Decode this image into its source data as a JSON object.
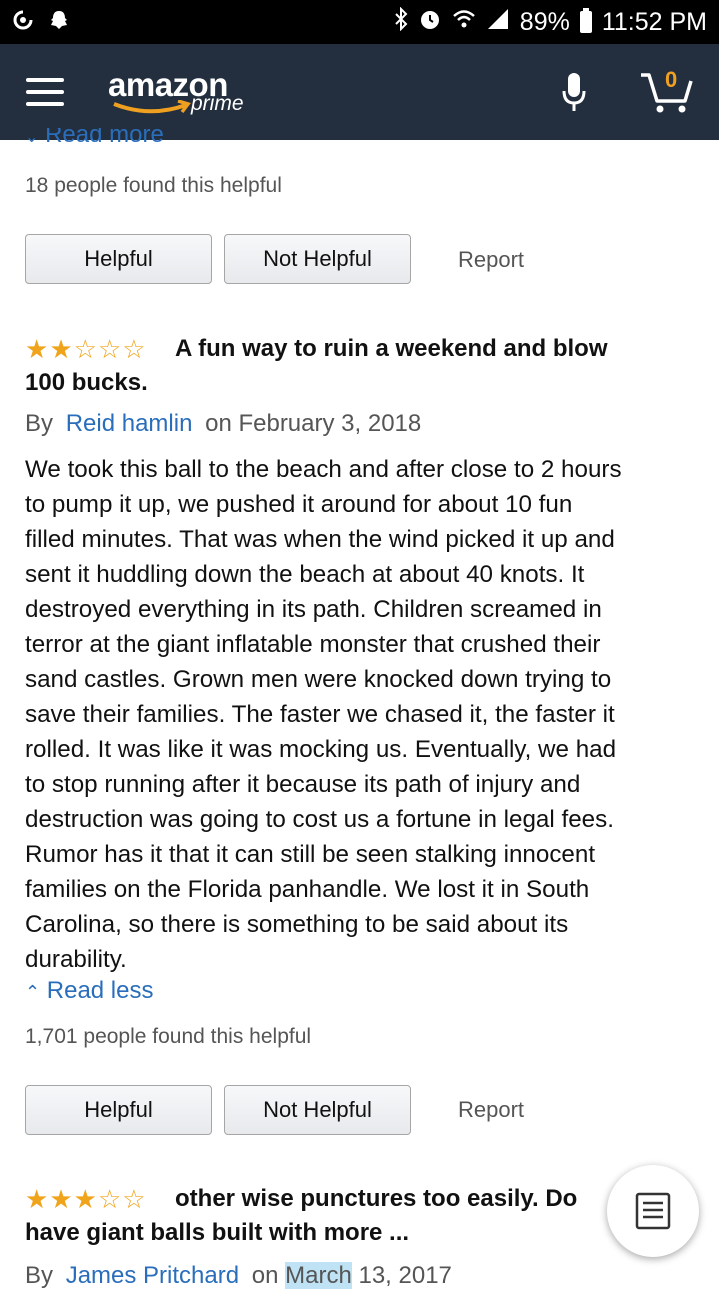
{
  "status_bar": {
    "battery": "89%",
    "time": "11:52 PM"
  },
  "header": {
    "logo_word": "amazon",
    "logo_sub": "prime",
    "cart_count": "0"
  },
  "top_partial": {
    "read_more": "Read more",
    "helpful_count": "18 people found this helpful"
  },
  "buttons": {
    "helpful": "Helpful",
    "not_helpful": "Not Helpful",
    "report": "Report"
  },
  "reviews": [
    {
      "stars": 2,
      "title_line1": "A fun way to ruin a weekend and blow",
      "title_line2": "100 bucks.",
      "by": "By",
      "author": "Reid hamlin",
      "on": "on February 3, 2018",
      "body": [
        "We took this ball to the beach and after close to 2 hours",
        "to pump it up, we pushed it around for about 10 fun",
        "filled minutes. That was when the wind picked it up and",
        "sent it huddling down the beach at about 40 knots. It",
        "destroyed everything in its path. Children screamed in",
        "terror at the giant inflatable monster that crushed their",
        "sand castles. Grown men were knocked down trying to",
        "save their families. The faster we chased it, the faster it",
        "rolled. It was like it was mocking us. Eventually, we had",
        "to stop running after it because its path of injury and",
        "destruction was going to cost us a fortune in legal fees.",
        "Rumor has it that it can still be seen stalking innocent",
        "families on the Florida panhandle. We lost it in South",
        "Carolina, so there is something to be said about its",
        "durability."
      ],
      "read_less": "Read less",
      "helpful_count": "1,701 people found this helpful"
    },
    {
      "stars": 3,
      "title_line1": "other wise punctures too easily. Do",
      "title_line2": "have giant balls built with more ...",
      "by": "By",
      "author": "James Pritchard",
      "on": "on",
      "date_highlight": "March",
      "date_rest": "13, 2017"
    }
  ]
}
